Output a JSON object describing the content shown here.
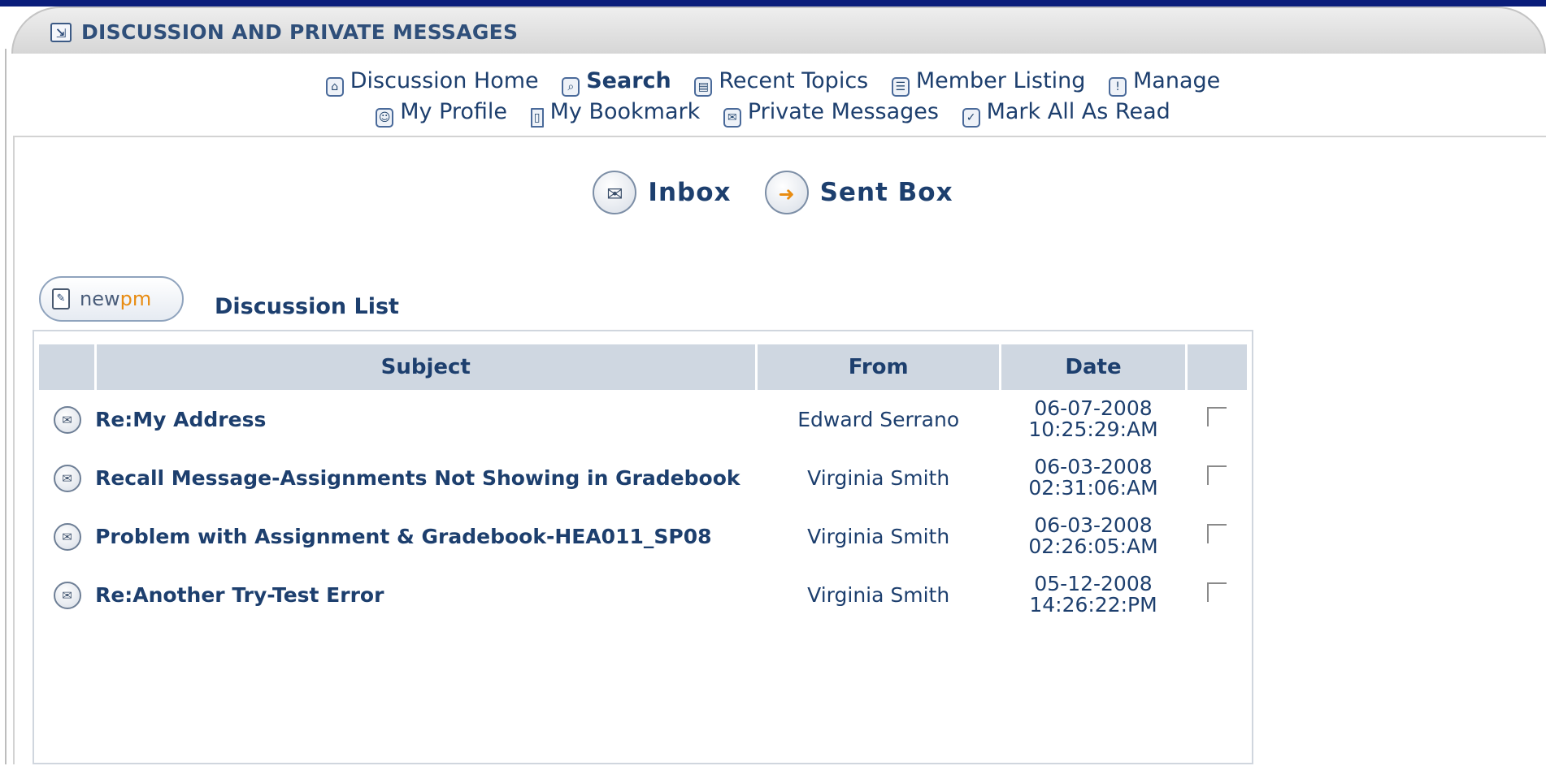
{
  "header": {
    "title": "DISCUSSION AND PRIVATE MESSAGES",
    "icon": "collapse-icon"
  },
  "nav": {
    "row1": [
      {
        "label": "Discussion Home",
        "icon": "home-icon"
      },
      {
        "label": "Search",
        "icon": "search-icon"
      },
      {
        "label": "Recent Topics",
        "icon": "recent-topics-icon"
      },
      {
        "label": "Member Listing",
        "icon": "member-list-icon"
      },
      {
        "label": "Manage",
        "icon": "manage-icon"
      }
    ],
    "row2": [
      {
        "label": "My Profile",
        "icon": "profile-icon"
      },
      {
        "label": "My Bookmark",
        "icon": "bookmark-icon"
      },
      {
        "label": "Private Messages",
        "icon": "private-messages-icon"
      },
      {
        "label": "Mark All As Read",
        "icon": "checkmark-icon"
      }
    ]
  },
  "boxes": {
    "inbox": "Inbox",
    "sent": "Sent Box"
  },
  "newpm": {
    "part1": "new",
    "part2": "pm"
  },
  "list_title": "Discussion List",
  "table": {
    "headers": [
      "",
      "Subject",
      "From",
      "Date",
      ""
    ],
    "rows": [
      {
        "subject": "Re:My Address",
        "from": "Edward Serrano",
        "date": "06-07-2008",
        "time": "10:25:29:AM"
      },
      {
        "subject": "Recall Message-Assignments Not Showing in Gradebook",
        "from": "Virginia Smith",
        "date": "06-03-2008",
        "time": "02:31:06:AM"
      },
      {
        "subject": "Problem with Assignment & Gradebook-HEA011_SP08",
        "from": "Virginia Smith",
        "date": "06-03-2008",
        "time": "02:26:05:AM"
      },
      {
        "subject": "Re:Another Try-Test Error",
        "from": "Virginia Smith",
        "date": "05-12-2008",
        "time": "14:26:22:PM"
      }
    ]
  },
  "colors": {
    "text": "#1d3f6e",
    "header_bg": "#cfd7e1",
    "accent": "#e88c12",
    "top_strip": "#0a1d7a"
  }
}
